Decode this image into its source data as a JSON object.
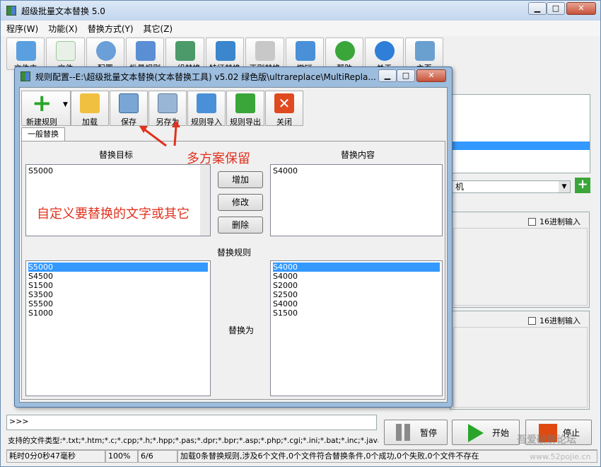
{
  "main_window": {
    "title": "超级批量文本替换 5.0",
    "menu": [
      "程序(W)",
      "功能(X)",
      "替换方式(Y)",
      "其它(Z)"
    ],
    "toolbar": [
      "文件夹",
      "文件",
      "配置",
      "批量规则",
      "一组替换",
      "特征替换",
      "正则替换",
      "撤销",
      "帮助",
      "关于",
      "主页"
    ]
  },
  "dialog": {
    "title": "规则配置--E:\\超级批量文本替换(文本替换工具) v5.02 绿色版\\ultrareplace\\MultiRepla...",
    "toolbar": {
      "new_rule": "新建规则",
      "load": "加载",
      "save": "保存",
      "save_as": "另存为",
      "import_rules": "规则导入",
      "export_rules": "规则导出",
      "close": "关闭"
    },
    "tab": "一般替换",
    "target_header": "替换目标",
    "content_header": "替换内容",
    "target_value": "S5000",
    "content_value": "S4000",
    "buttons": {
      "add": "增加",
      "modify": "修改",
      "delete": "删除"
    },
    "rules_header": "替换规则",
    "replace_as": "替换为",
    "targets": [
      "S5000",
      "S4500",
      "S1500",
      "S3500",
      "S5500",
      "S1000"
    ],
    "replacements": [
      "S4000",
      "S4000",
      "S2000",
      "S2500",
      "S4000",
      "S1500"
    ]
  },
  "annotations": {
    "multi_plan": "多方案保留",
    "custom_text": "自定义要替换的文字或其它"
  },
  "right_panel": {
    "combo_text": "机",
    "hex_input_label": "16进制输入"
  },
  "bottom": {
    "prompt": ">>>",
    "file_types": "支持的文件类型:*.txt;*.htm;*.c;*.cpp;*.h;*.hpp;*.pas;*.dpr;*.bpr;*.asp;*.php;*.cgi;*.ini;*.bat;*.inc;*.java;*.py;*.dfm",
    "pause": "暂停",
    "start": "开始",
    "stop": "停止"
  },
  "status": {
    "elapsed": "耗时0分0秒47毫秒",
    "percent": "100%",
    "count": "6/6",
    "message": "加载0条替换规则,涉及6个文件,0个文件符合替换条件,0个成功,0个失败,0个文件不存在"
  },
  "watermark": {
    "line1": "吾爱破解论坛",
    "line2": "www.52pojie.cn"
  },
  "colors": {
    "annotation_red": "#e0321e",
    "selection_blue": "#3399ff",
    "dialog_frame": "#9dbdde"
  }
}
